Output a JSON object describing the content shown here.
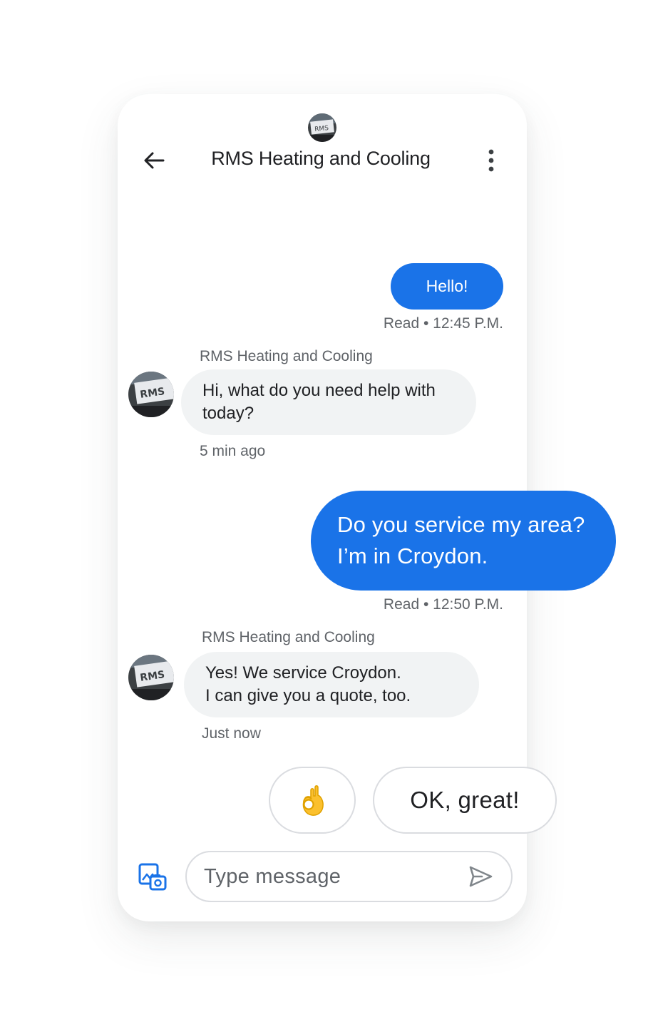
{
  "header": {
    "title": "RMS Heating and Cooling",
    "avatar_icon": "business-logo-avatar",
    "back_icon": "arrow-back-icon",
    "menu_icon": "more-vert-icon"
  },
  "messages": [
    {
      "direction": "outgoing",
      "text": "Hello!",
      "status": "Read • 12:45 P.M."
    },
    {
      "direction": "incoming",
      "sender": "RMS Heating and Cooling",
      "text": "Hi, what do you need help with\ntoday?",
      "time": "5 min ago"
    },
    {
      "direction": "outgoing",
      "text": "Do you service my area?\nI’m in Croydon.",
      "status": "Read • 12:50 P.M."
    },
    {
      "direction": "incoming",
      "sender": "RMS Heating and Cooling",
      "text": "Yes! We service Croydon.\nI can give you a quote, too.",
      "time": "Just now"
    }
  ],
  "suggestions": [
    {
      "label": "👌",
      "icon": "ok-hand-emoji"
    },
    {
      "label": "OK, great!"
    }
  ],
  "composer": {
    "placeholder": "Type message",
    "attach_icon": "add-photo-icon",
    "send_icon": "send-icon"
  },
  "colors": {
    "accent": "#1a73e8",
    "incoming_bubble": "#f1f3f4",
    "text_primary": "#202124",
    "text_secondary": "#5f6368",
    "border": "#dadce0"
  }
}
